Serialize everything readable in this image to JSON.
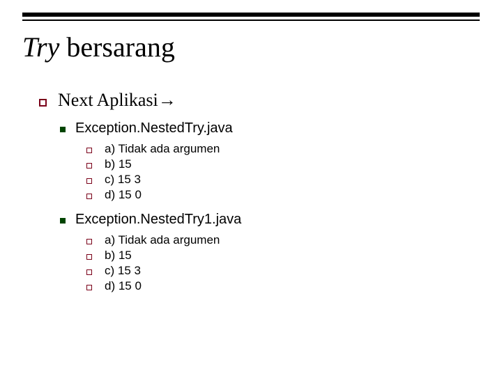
{
  "title_italic": "Try",
  "title_rest": " bersarang",
  "level1_text": "Next Aplikasi",
  "level1_arrow": "→",
  "sections": [
    {
      "heading": "Exception.NestedTry.java",
      "items": [
        "a) Tidak ada argumen",
        "b) 15",
        "c) 15 3",
        "d) 15 0"
      ]
    },
    {
      "heading": "Exception.NestedTry1.java",
      "items": [
        "a) Tidak ada argumen",
        "b) 15",
        "c) 15 3",
        "d) 15 0"
      ]
    }
  ]
}
